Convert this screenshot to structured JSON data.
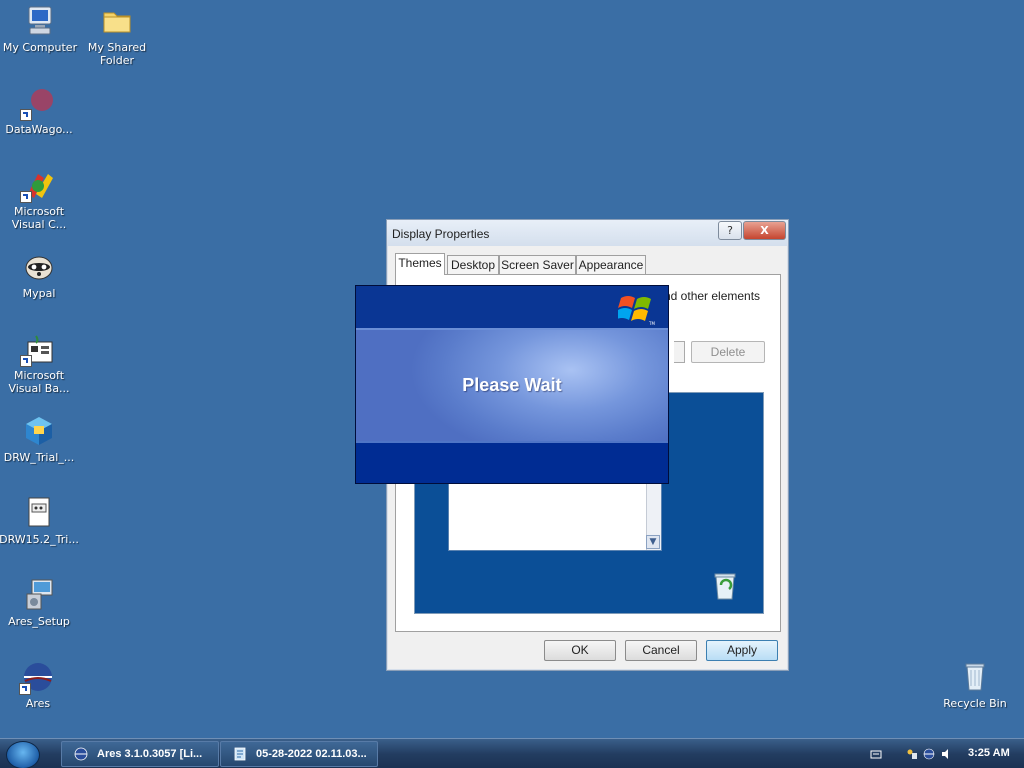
{
  "desktop": {
    "background_color": "#3a6ea5",
    "icons": [
      {
        "label": "My Computer",
        "icon": "computer-icon"
      },
      {
        "label": "My Shared Folder",
        "icon": "folder-icon"
      },
      {
        "label": "DataWago...",
        "icon": "datawago-icon"
      },
      {
        "label": "Microsoft Visual C...",
        "icon": "visual-c-icon"
      },
      {
        "label": "Mypal",
        "icon": "mypal-icon"
      },
      {
        "label": "Microsoft Visual Ba...",
        "icon": "visual-basic-icon"
      },
      {
        "label": "DRW_Trial_...",
        "icon": "installer-icon"
      },
      {
        "label": "DRW15.2_Tri...",
        "icon": "document-icon"
      },
      {
        "label": "Ares_Setup",
        "icon": "setup-icon"
      },
      {
        "label": "Ares",
        "icon": "ares-icon"
      },
      {
        "label": "Recycle Bin",
        "icon": "recycle-bin-icon"
      }
    ]
  },
  "display_properties": {
    "title": "Display Properties",
    "help_label": "?",
    "close_label": "X",
    "tabs": [
      {
        "label": "Themes",
        "active": true
      },
      {
        "label": "Desktop",
        "active": false
      },
      {
        "label": "Screen Saver",
        "active": false
      },
      {
        "label": "Appearance",
        "active": false
      }
    ],
    "description_fragment": "nd other elements",
    "delete_label": "Delete",
    "ok_label": "OK",
    "cancel_label": "Cancel",
    "apply_label": "Apply",
    "preview_background": "#0b4f97"
  },
  "please_wait": {
    "text": "Please Wait",
    "logo": "windows-flag-icon",
    "logo_tm": "TM"
  },
  "taskbar": {
    "start_icon": "start-orb-icon",
    "buttons": [
      {
        "label": "Ares 3.1.0.3057   [Li...",
        "icon": "ares-icon"
      },
      {
        "label": "05-28-2022 02.11.03...",
        "icon": "notepad-icon"
      }
    ],
    "tray_icons": [
      "keyboard-icon",
      "network-icon",
      "ares-tray-icon",
      "volume-icon"
    ],
    "clock": "3:25 AM"
  }
}
